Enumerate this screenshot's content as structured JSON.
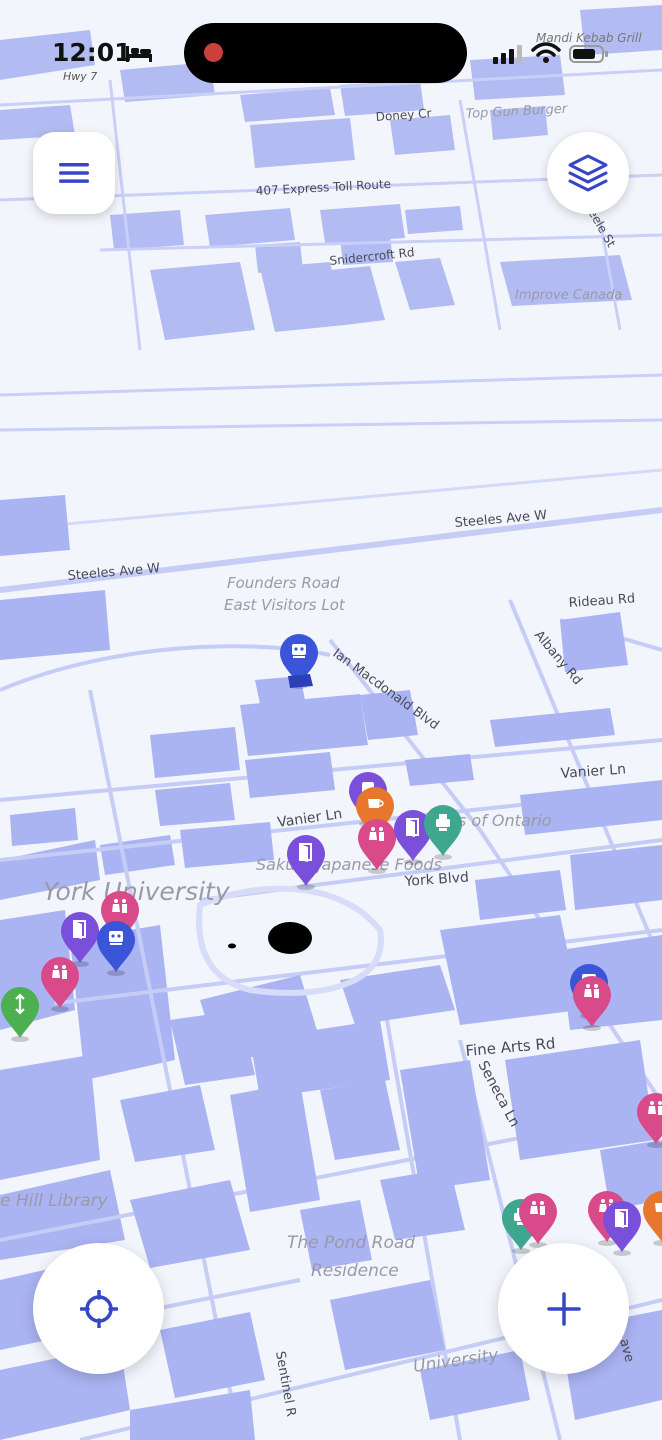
{
  "status_bar": {
    "time": "12:01",
    "location_hint": "Hwy 7",
    "top_right_place": "Mandi Kebab Grill"
  },
  "map": {
    "street_labels": {
      "doney_cr": "Doney Cr",
      "top_gun_burger": "Top Gun Burger",
      "express_toll": "407 Express Toll Route",
      "steele_st": "eele St",
      "snidercroft": "Snidercroft Rd",
      "improve_canada": "Improve Canada",
      "steeles_ave_right": "Steeles Ave W",
      "steeles_ave_left": "Steeles Ave W",
      "founders_road": "Founders Road",
      "east_visitors_lot": "East Visitors Lot",
      "rideau_rd": "Rideau Rd",
      "albany_rd": "Albany Rd",
      "ian_macdonald": "Ian Macdonald Blvd",
      "vanier_ln_right": "Vanier Ln",
      "vanier_ln_left": "Vanier Ln",
      "of_ontario": "s of Ontario",
      "sakura": "Sakura Japanese Foods",
      "york_blvd": "York Blvd",
      "york_university": "York University",
      "fine_arts_rd": "Fine Arts Rd",
      "seneca_ln": "Seneca Ln",
      "library": "e Hill Library",
      "pond_road_1": "The Pond Road",
      "pond_road_2": "Residence",
      "university": "University",
      "sentinel": "Sentinel R",
      "ave": "ave"
    },
    "markers": [
      {
        "type": "elevator",
        "color": "#3a55d8"
      },
      {
        "type": "food",
        "color": "#7a4fd9"
      },
      {
        "type": "coffee",
        "color": "#e8772e"
      },
      {
        "type": "restroom",
        "color": "#d94a8a"
      },
      {
        "type": "door",
        "color": "#7a4fd9"
      },
      {
        "type": "printer",
        "color": "#3fa690"
      },
      {
        "type": "door",
        "color": "#7a4fd9"
      },
      {
        "type": "restroom",
        "color": "#d94a8a"
      },
      {
        "type": "door",
        "color": "#7a4fd9"
      },
      {
        "type": "elevator",
        "color": "#3a55d8"
      },
      {
        "type": "restroom",
        "color": "#d94a8a"
      },
      {
        "type": "stairs",
        "color": "#4caf50"
      },
      {
        "type": "elevator",
        "color": "#3a55d8"
      },
      {
        "type": "restroom",
        "color": "#d94a8a"
      },
      {
        "type": "restroom",
        "color": "#d94a8a"
      },
      {
        "type": "printer",
        "color": "#3fa690"
      },
      {
        "type": "restroom",
        "color": "#d94a8a"
      },
      {
        "type": "restroom",
        "color": "#d94a8a"
      },
      {
        "type": "door",
        "color": "#7a4fd9"
      },
      {
        "type": "coffee",
        "color": "#e8772e"
      }
    ]
  },
  "controls": {
    "menu_icon": "hamburger-icon",
    "layers_icon": "layers-icon",
    "locate_icon": "crosshair-icon",
    "add_icon": "plus-icon"
  },
  "colors": {
    "accent": "#3646c8",
    "building": "#aab4f2",
    "road": "#c5ccf6",
    "background": "#f3f5fc"
  }
}
